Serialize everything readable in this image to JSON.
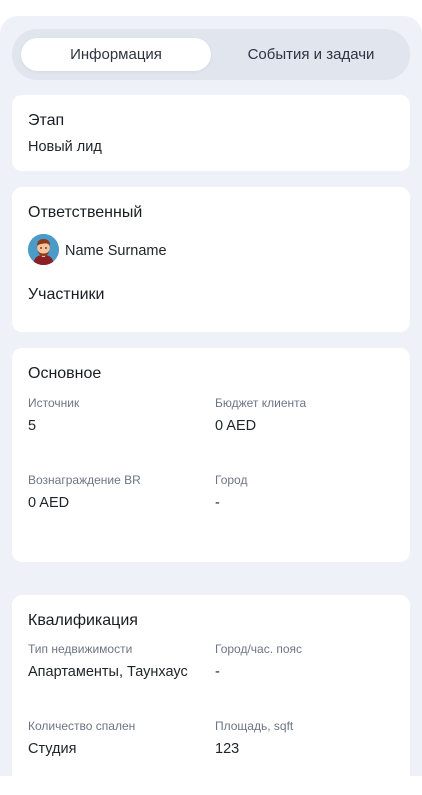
{
  "tabs": [
    {
      "label": "Информация",
      "active": true
    },
    {
      "label": "События и задачи",
      "active": false
    }
  ],
  "stage": {
    "title": "Этап",
    "value": "Новый лид"
  },
  "responsible": {
    "title": "Ответственный",
    "person_name": "Name Surname",
    "participants_title": "Участники"
  },
  "main": {
    "title": "Основное",
    "fields": [
      {
        "label": "Источник",
        "value": "5"
      },
      {
        "label": "Бюджет клиента",
        "value": "0 AED"
      },
      {
        "label": "Вознаграждение BR",
        "value": "0 AED"
      },
      {
        "label": "Город",
        "value": "-"
      }
    ]
  },
  "qualification": {
    "title": "Квалификация",
    "fields": [
      {
        "label": "Тип недвижимости",
        "value": "Апартаменты, Таунхаус"
      },
      {
        "label": "Город/час. пояс",
        "value": "-"
      },
      {
        "label": "Количество спален",
        "value": "Студия"
      },
      {
        "label": "Площадь, sqft",
        "value": "123"
      }
    ]
  },
  "colors": {
    "background": "#eef1f8",
    "card": "#ffffff",
    "muted_label": "#6d7585"
  }
}
